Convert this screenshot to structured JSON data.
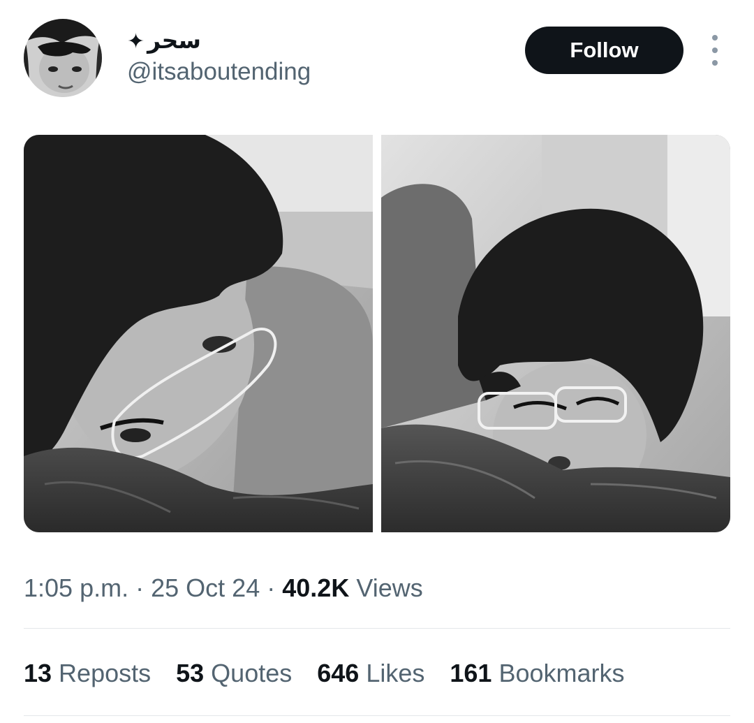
{
  "author": {
    "display_name": "سحر",
    "display_badge": "✦",
    "handle": "@itsaboutending"
  },
  "actions": {
    "follow_label": "Follow",
    "more_icon": "more-vertical-icon"
  },
  "media": {
    "count": 2,
    "style": "black-and-white photographs"
  },
  "meta": {
    "time": "1:05 p.m.",
    "separator": "·",
    "date": "25 Oct 24",
    "views_count": "40.2K",
    "views_label": "Views"
  },
  "stats": {
    "reposts_count": "13",
    "reposts_label": "Reposts",
    "quotes_count": "53",
    "quotes_label": "Quotes",
    "likes_count": "646",
    "likes_label": "Likes",
    "bookmarks_count": "161",
    "bookmarks_label": "Bookmarks"
  },
  "colors": {
    "text_primary": "#0f1419",
    "text_secondary": "#536471",
    "button_bg": "#0f1419",
    "divider": "#e3e7ea"
  }
}
